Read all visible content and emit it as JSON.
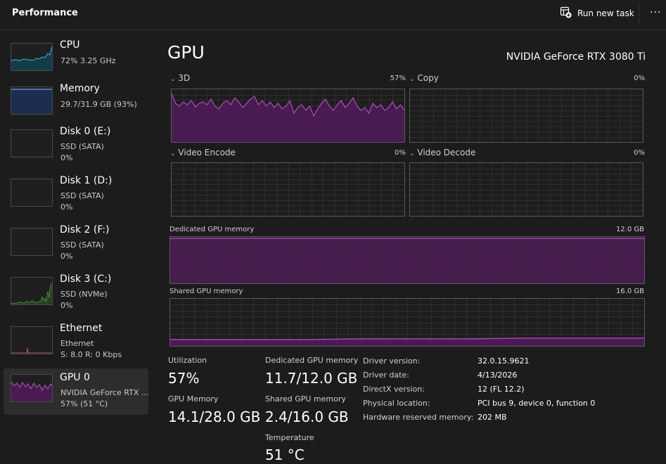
{
  "header": {
    "title": "Performance",
    "run_new_task": "Run new task",
    "more": "···"
  },
  "sidebar": {
    "items": [
      {
        "name": "CPU",
        "sub1": "72%  3.25 GHz",
        "sub2": "",
        "color": "#2aa6c9"
      },
      {
        "name": "Memory",
        "sub1": "29.7/31.9 GB (93%)",
        "sub2": "",
        "color": "#5d8ed6"
      },
      {
        "name": "Disk 0 (E:)",
        "sub1": "SSD (SATA)",
        "sub2": "0%",
        "color": "#71b35b"
      },
      {
        "name": "Disk 1 (D:)",
        "sub1": "SSD (SATA)",
        "sub2": "0%",
        "color": "#71b35b"
      },
      {
        "name": "Disk 2 (F:)",
        "sub1": "SSD (SATA)",
        "sub2": "0%",
        "color": "#71b35b"
      },
      {
        "name": "Disk 3 (C:)",
        "sub1": "SSD (NVMe)",
        "sub2": "0%",
        "color": "#71b35b"
      },
      {
        "name": "Ethernet",
        "sub1": "Ethernet",
        "sub2": "S: 8.0  R: 0 Kbps",
        "color": "#b6527a"
      },
      {
        "name": "GPU 0",
        "sub1": "NVIDIA GeForce RTX ...",
        "sub2": "57%  (51 °C)",
        "color": "#a34bb0"
      }
    ],
    "selected": "GPU 0"
  },
  "main": {
    "title": "GPU",
    "model": "NVIDIA GeForce RTX 3080 Ti",
    "engines": [
      {
        "label": "3D",
        "percent": "57%"
      },
      {
        "label": "Copy",
        "percent": "0%"
      },
      {
        "label": "Video Encode",
        "percent": "0%"
      },
      {
        "label": "Video Decode",
        "percent": "0%"
      }
    ],
    "dedicated_memory": {
      "label": "Dedicated GPU memory",
      "max": "12.0 GB"
    },
    "shared_memory": {
      "label": "Shared GPU memory",
      "max": "16.0 GB"
    },
    "stats": {
      "utilization_label": "Utilization",
      "utilization": "57%",
      "dedicated_label": "Dedicated GPU memory",
      "dedicated": "11.7/12.0 GB",
      "gpu_memory_label": "GPU Memory",
      "gpu_memory": "14.1/28.0 GB",
      "shared_label": "Shared GPU memory",
      "shared": "2.4/16.0 GB",
      "temperature_label": "Temperature",
      "temperature": "51 °C"
    },
    "details": [
      {
        "key": "Driver version:",
        "value": "32.0.15.9621"
      },
      {
        "key": "Driver date:",
        "value": "4/13/2026"
      },
      {
        "key": "DirectX version:",
        "value": "12 (FL 12.2)"
      },
      {
        "key": "Physical location:",
        "value": "PCI bus 9, device 0, function 0"
      },
      {
        "key": "Hardware reserved memory:",
        "value": "202 MB"
      }
    ]
  },
  "colors": {
    "accent": "#a34bb0",
    "fill": "#4a1a52"
  }
}
